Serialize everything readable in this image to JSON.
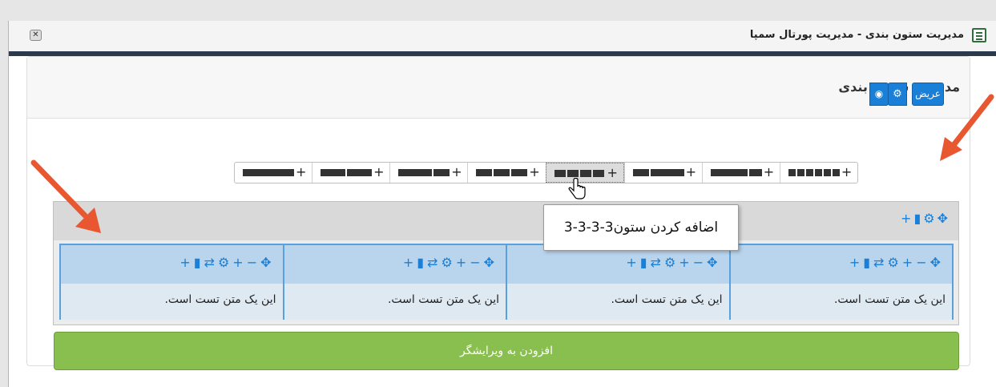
{
  "window": {
    "title": "مدیریت ستون بندی - مدیریت پورتال سمپا",
    "close_icon": "close-icon"
  },
  "panel": {
    "title": "مدیریت ستون بندی"
  },
  "toolbar": {
    "width_label": "عریض",
    "gear_icon": "gear-icon",
    "eye_icon": "eye-icon"
  },
  "layouts": [
    {
      "name": "12"
    },
    {
      "name": "6-6"
    },
    {
      "name": "8-4"
    },
    {
      "name": "4-4-4"
    },
    {
      "name": "3-3-3-3"
    },
    {
      "name": "4-8"
    },
    {
      "name": "9-3"
    },
    {
      "name": "2-2-2-2-2-2"
    }
  ],
  "tooltip": {
    "text": "اضافه کردن ستون3-3-3-3"
  },
  "row": {
    "tools": [
      "plus-icon",
      "trash-icon",
      "gear-icon",
      "move-icon"
    ]
  },
  "columns": [
    {
      "text": "این یک متن تست است."
    },
    {
      "text": "این یک متن تست است."
    },
    {
      "text": "این یک متن تست است."
    },
    {
      "text": "این یک متن تست است."
    }
  ],
  "add_button": {
    "label": "افزودن به ویرایشگر"
  },
  "colors": {
    "primary": "#1a7fd6",
    "success": "#89bf4e",
    "column_border": "#5aa0dc",
    "arrow": "#e8572f"
  }
}
